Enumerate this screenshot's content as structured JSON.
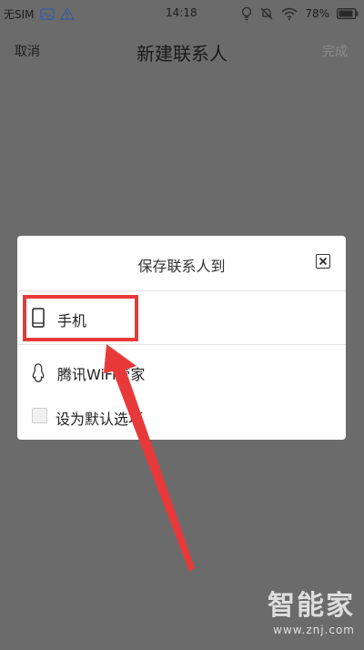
{
  "status_bar": {
    "carrier": "无SIM",
    "time": "14:18",
    "battery": "78%",
    "icons": [
      "gallery-icon",
      "alert-icon",
      "location-icon",
      "mute-icon",
      "wifi-icon",
      "battery-icon"
    ]
  },
  "title_bar": {
    "cancel_label": "取消",
    "title": "新建联系人",
    "done_label": "完成"
  },
  "dialog": {
    "title": "保存联系人到",
    "options": [
      {
        "label": "手机",
        "icon": "phone-icon"
      },
      {
        "label": "腾讯WiFi管家",
        "icon": "tencent-icon"
      }
    ],
    "default_checkbox_label": "设为默认选项",
    "default_checked": false
  },
  "annotation": {
    "highlight_color": "#e8393a"
  },
  "watermark": {
    "logo": "智能家",
    "url": "www.znj.com"
  },
  "colors": {
    "overlay_background": "#6b6b6b",
    "dialog_background": "#ffffff",
    "annotation_red": "#e8393a"
  }
}
